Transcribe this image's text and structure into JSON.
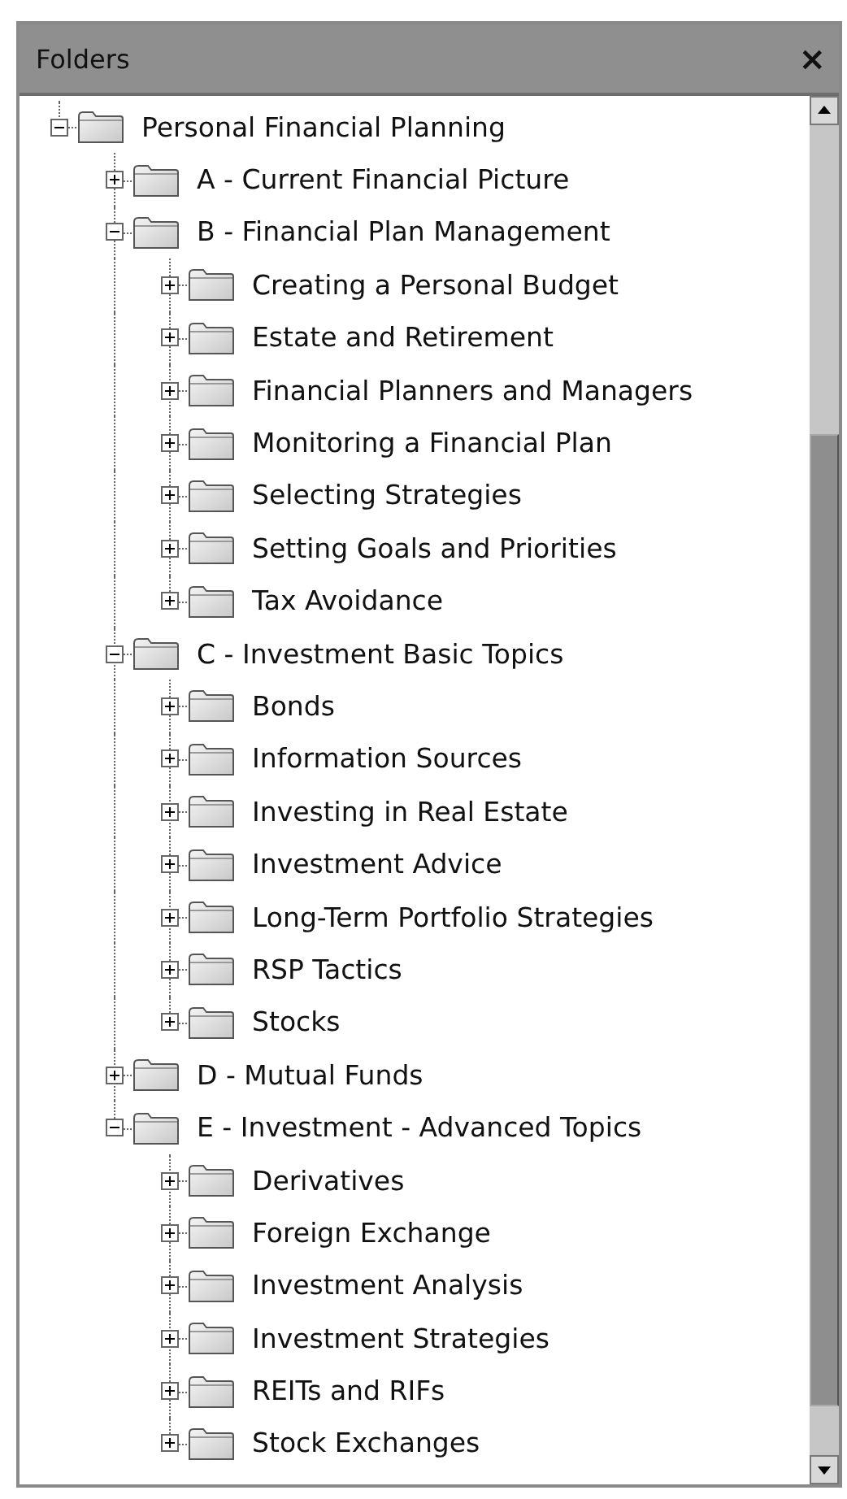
{
  "panel": {
    "title": "Folders",
    "close": "×"
  },
  "tree": [
    {
      "label": "Personal Financial Planning",
      "expanded": true,
      "children": [
        {
          "label": "A - Current Financial Picture",
          "expanded": false
        },
        {
          "label": "B - Financial Plan Management",
          "expanded": true,
          "children": [
            {
              "label": "Creating a Personal Budget",
              "expanded": false
            },
            {
              "label": "Estate and Retirement",
              "expanded": false
            },
            {
              "label": "Financial Planners and Managers",
              "expanded": false
            },
            {
              "label": "Monitoring a Financial Plan",
              "expanded": false
            },
            {
              "label": "Selecting Strategies",
              "expanded": false
            },
            {
              "label": "Setting Goals and Priorities",
              "expanded": false
            },
            {
              "label": "Tax Avoidance",
              "expanded": false
            }
          ]
        },
        {
          "label": "C - Investment Basic Topics",
          "expanded": true,
          "children": [
            {
              "label": "Bonds",
              "expanded": false
            },
            {
              "label": "Information Sources",
              "expanded": false
            },
            {
              "label": "Investing in Real Estate",
              "expanded": false
            },
            {
              "label": "Investment Advice",
              "expanded": false
            },
            {
              "label": "Long-Term Portfolio Strategies",
              "expanded": false
            },
            {
              "label": "RSP Tactics",
              "expanded": false
            },
            {
              "label": "Stocks",
              "expanded": false
            }
          ]
        },
        {
          "label": "D - Mutual Funds",
          "expanded": false
        },
        {
          "label": "E - Investment - Advanced Topics",
          "expanded": true,
          "children": [
            {
              "label": "Derivatives",
              "expanded": false
            },
            {
              "label": "Foreign Exchange",
              "expanded": false
            },
            {
              "label": "Investment Analysis",
              "expanded": false
            },
            {
              "label": "Investment Strategies",
              "expanded": false
            },
            {
              "label": "REITs and RIFs",
              "expanded": false
            },
            {
              "label": "Stock Exchanges",
              "expanded": false
            }
          ]
        }
      ]
    }
  ]
}
